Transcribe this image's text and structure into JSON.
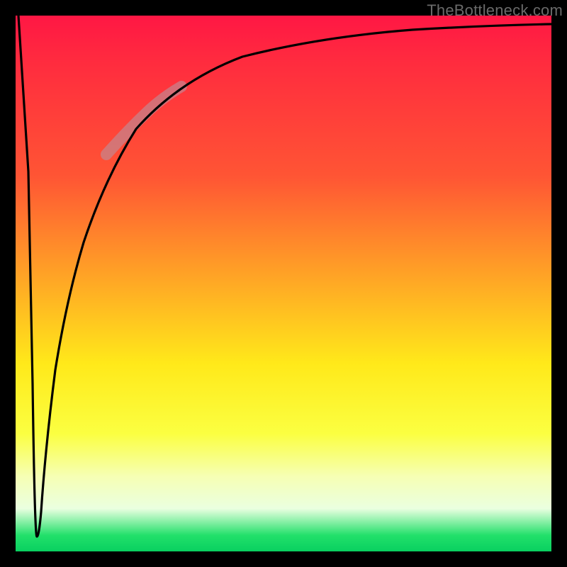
{
  "watermark": "TheBottleneck.com",
  "chart_data": {
    "type": "line",
    "title": "",
    "xlabel": "",
    "ylabel": "",
    "xlim": [
      0,
      100
    ],
    "ylim": [
      0,
      100
    ],
    "grid": false,
    "legend": false,
    "annotations": [
      {
        "kind": "highlight-segment",
        "x_start": 17,
        "x_end": 31,
        "style": "thick-translucent"
      }
    ],
    "series": [
      {
        "name": "curve",
        "x": [
          0,
          2,
          3,
          3.5,
          4,
          4.5,
          5,
          6,
          7,
          8,
          10,
          13,
          17,
          22,
          28,
          35,
          45,
          60,
          80,
          100
        ],
        "y": [
          100,
          60,
          20,
          6,
          3,
          6,
          14,
          28,
          40,
          49,
          59,
          68,
          74,
          80,
          84,
          88,
          91,
          93.5,
          95,
          96
        ]
      }
    ],
    "gradient_stops": [
      {
        "pos": 0.0,
        "color": "#ff1744"
      },
      {
        "pos": 0.3,
        "color": "#ff5534"
      },
      {
        "pos": 0.48,
        "color": "#ffa126"
      },
      {
        "pos": 0.65,
        "color": "#ffe91a"
      },
      {
        "pos": 0.86,
        "color": "#f6ffb4"
      },
      {
        "pos": 0.97,
        "color": "#22e06a"
      },
      {
        "pos": 1.0,
        "color": "#09d060"
      }
    ]
  }
}
